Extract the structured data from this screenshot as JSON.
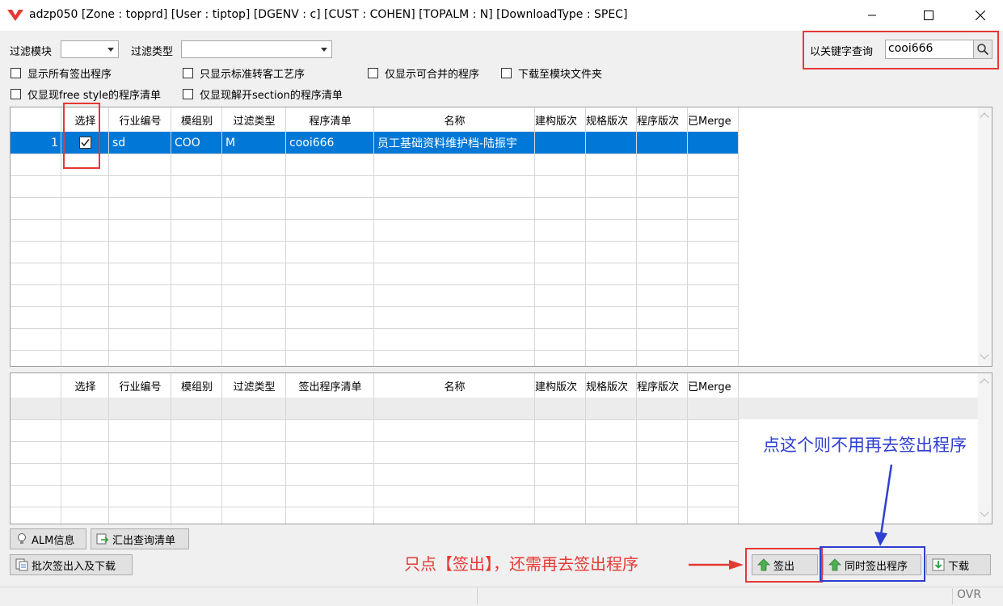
{
  "window": {
    "title": "adzp050 [Zone : topprd]  [User : tiptop]  [DGENV : c]  [CUST : COHEN]  [TOPALM : N]  [DownloadType : SPEC]"
  },
  "filters": {
    "module_label": "过滤模块",
    "type_label": "过滤类型",
    "checkboxes": [
      {
        "label": "显示所有签出程序",
        "checked": false
      },
      {
        "label": "只显示标准转客工艺序",
        "checked": false
      },
      {
        "label": "仅显示可合并的程序",
        "checked": false
      },
      {
        "label": "下载至模块文件夹",
        "checked": false
      },
      {
        "label": "仅显现free style的程序清单",
        "checked": false
      },
      {
        "label": "仅显现解开section的程序清单",
        "checked": false
      }
    ]
  },
  "search": {
    "label": "以关键字查询",
    "value": "cooi666"
  },
  "upper_grid": {
    "headers": [
      "选择",
      "行业编号",
      "模组别",
      "过滤类型",
      "程序清单",
      "名称",
      "建构版次",
      "规格版次",
      "程序版次",
      "已Merge"
    ],
    "rows": [
      {
        "num": "1",
        "checked": true,
        "industry": "sd",
        "module": "COO",
        "type": "M",
        "program": "cooi666",
        "name": "员工基础资料维护档-陆振宇"
      }
    ]
  },
  "lower_grid": {
    "headers": [
      "选择",
      "行业编号",
      "模组别",
      "过滤类型",
      "签出程序清单",
      "名称",
      "建构版次",
      "规格版次",
      "程序版次",
      "已Merge"
    ]
  },
  "buttons": {
    "alm": "ALM信息",
    "export": "汇出查询清单",
    "batch": "批次签出入及下载",
    "checkout": "签出",
    "checkout_program": "同时签出程序",
    "download": "下载"
  },
  "annotations": {
    "blue": "点这个则不用再去签出程序",
    "red": "只点【签出】，还需再去签出程序"
  },
  "status": {
    "ovr": "OVR"
  },
  "colors": {
    "selection": "#0078d7",
    "highlight_red": "#e53935",
    "highlight_blue": "#2e3fd1"
  }
}
